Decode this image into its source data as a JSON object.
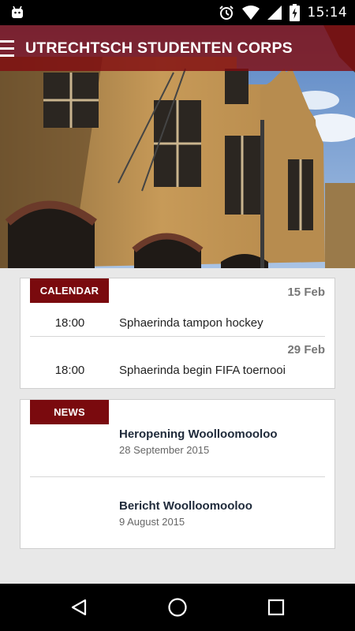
{
  "status_bar": {
    "time": "15:14",
    "icons": [
      "android-icon",
      "alarm-icon",
      "wifi-icon",
      "signal-icon",
      "battery-charging-icon"
    ]
  },
  "app_bar": {
    "title": "UTRECHTSCH STUDENTEN CORPS",
    "menu_icon": "hamburger-menu-icon",
    "color": "#7a0a0e"
  },
  "calendar": {
    "label": "CALENDAR",
    "days": [
      {
        "date": "15 Feb",
        "events": [
          {
            "time": "18:00",
            "title": "Sphaerinda tampon hockey"
          }
        ]
      },
      {
        "date": "29 Feb",
        "events": [
          {
            "time": "18:00",
            "title": "Sphaerinda begin FIFA toernooi"
          }
        ]
      }
    ]
  },
  "news": {
    "label": "NEWS",
    "items": [
      {
        "title": "Heropening Woolloomooloo",
        "date": "28 September 2015"
      },
      {
        "title": "Bericht Woolloomooloo",
        "date": "9 August 2015"
      }
    ]
  },
  "nav_bar": {
    "buttons": [
      "back-icon",
      "home-icon",
      "recents-icon"
    ]
  }
}
